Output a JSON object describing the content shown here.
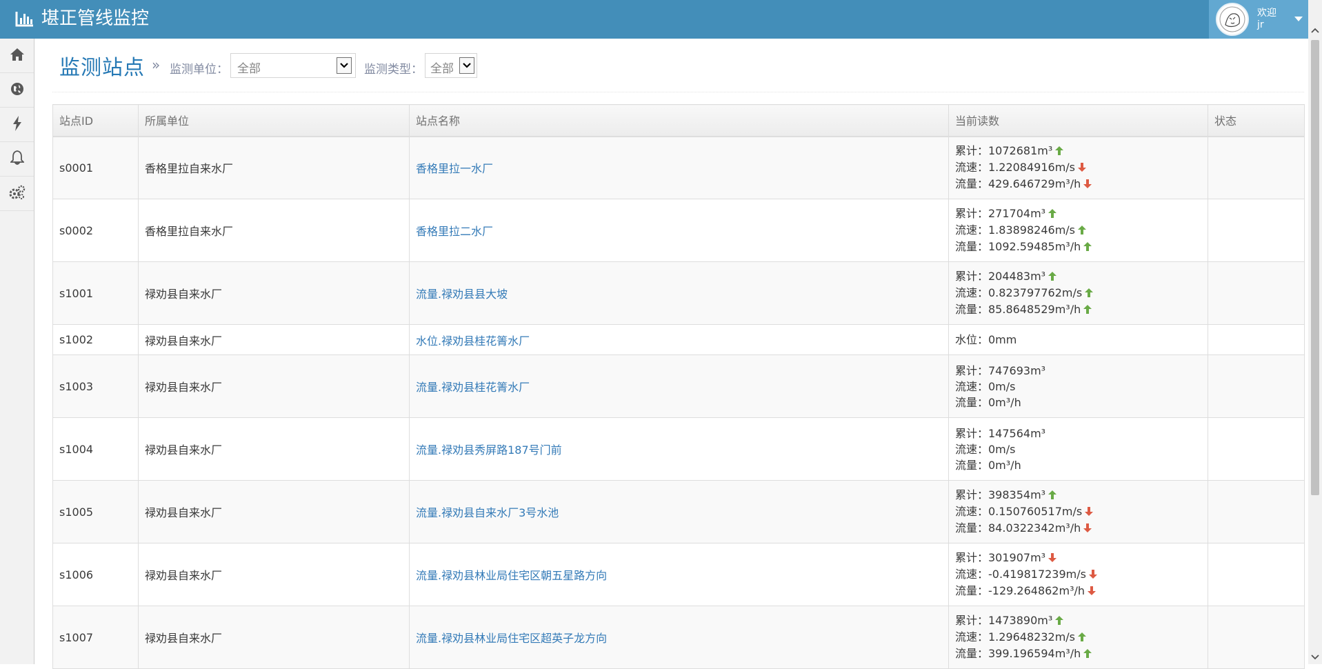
{
  "app": {
    "title": "堪正管线监控"
  },
  "user": {
    "welcome": "欢迎",
    "name": "jr"
  },
  "sidebar": {
    "items": [
      {
        "icon": "home-icon"
      },
      {
        "icon": "globe-icon"
      },
      {
        "icon": "bolt-icon"
      },
      {
        "icon": "bell-icon"
      },
      {
        "icon": "gears-icon"
      }
    ]
  },
  "page": {
    "title": "监测站点",
    "separator": "»",
    "filters": {
      "unit_label": "监测单位：",
      "unit_value": "全部",
      "type_label": "监测类型：",
      "type_value": "全部"
    }
  },
  "table": {
    "headers": [
      "站点ID",
      "所属单位",
      "站点名称",
      "当前读数",
      "状态"
    ],
    "rows": [
      {
        "id": "s0001",
        "unit": "香格里拉自来水厂",
        "name": "香格里拉一水厂",
        "readings": [
          {
            "text": "累计：1072681m³",
            "trend": "up"
          },
          {
            "text": "流速：1.22084916m/s",
            "trend": "down"
          },
          {
            "text": "流量：429.646729m³/h",
            "trend": "down"
          }
        ],
        "status": ""
      },
      {
        "id": "s0002",
        "unit": "香格里拉自来水厂",
        "name": "香格里拉二水厂",
        "readings": [
          {
            "text": "累计：271704m³",
            "trend": "up"
          },
          {
            "text": "流速：1.83898246m/s",
            "trend": "up"
          },
          {
            "text": "流量：1092.59485m³/h",
            "trend": "up"
          }
        ],
        "status": ""
      },
      {
        "id": "s1001",
        "unit": "禄劝县自来水厂",
        "name": "流量.禄劝县县大坡",
        "readings": [
          {
            "text": "累计：204483m³",
            "trend": "up"
          },
          {
            "text": "流速：0.823797762m/s",
            "trend": "up"
          },
          {
            "text": "流量：85.8648529m³/h",
            "trend": "up"
          }
        ],
        "status": ""
      },
      {
        "id": "s1002",
        "unit": "禄劝县自来水厂",
        "name": "水位.禄劝县桂花箐水厂",
        "readings": [
          {
            "text": "水位：0mm",
            "trend": ""
          }
        ],
        "status": ""
      },
      {
        "id": "s1003",
        "unit": "禄劝县自来水厂",
        "name": "流量.禄劝县桂花箐水厂",
        "readings": [
          {
            "text": "累计：747693m³",
            "trend": ""
          },
          {
            "text": "流速：0m/s",
            "trend": ""
          },
          {
            "text": "流量：0m³/h",
            "trend": ""
          }
        ],
        "status": ""
      },
      {
        "id": "s1004",
        "unit": "禄劝县自来水厂",
        "name": "流量.禄劝县秀屏路187号门前",
        "readings": [
          {
            "text": "累计：147564m³",
            "trend": ""
          },
          {
            "text": "流速：0m/s",
            "trend": ""
          },
          {
            "text": "流量：0m³/h",
            "trend": ""
          }
        ],
        "status": ""
      },
      {
        "id": "s1005",
        "unit": "禄劝县自来水厂",
        "name": "流量.禄劝县自来水厂3号水池",
        "readings": [
          {
            "text": "累计：398354m³",
            "trend": "up"
          },
          {
            "text": "流速：0.150760517m/s",
            "trend": "down"
          },
          {
            "text": "流量：84.0322342m³/h",
            "trend": "down"
          }
        ],
        "status": ""
      },
      {
        "id": "s1006",
        "unit": "禄劝县自来水厂",
        "name": "流量.禄劝县林业局住宅区朝五星路方向",
        "readings": [
          {
            "text": "累计：301907m³",
            "trend": "down"
          },
          {
            "text": "流速：-0.419817239m/s",
            "trend": "down"
          },
          {
            "text": "流量：-129.264862m³/h",
            "trend": "down"
          }
        ],
        "status": ""
      },
      {
        "id": "s1007",
        "unit": "禄劝县自来水厂",
        "name": "流量.禄劝县林业局住宅区超英子龙方向",
        "readings": [
          {
            "text": "累计：1473890m³",
            "trend": "up"
          },
          {
            "text": "流速：1.29648232m/s",
            "trend": "up"
          },
          {
            "text": "流量：399.196594m³/h",
            "trend": "up"
          }
        ],
        "status": ""
      }
    ]
  },
  "colors": {
    "topbar": "#438eb9",
    "userbox": "#62a8d1",
    "title": "#2679b5",
    "link": "#337ab7",
    "trend_up": "#69aa46",
    "trend_down": "#dd5a43"
  }
}
